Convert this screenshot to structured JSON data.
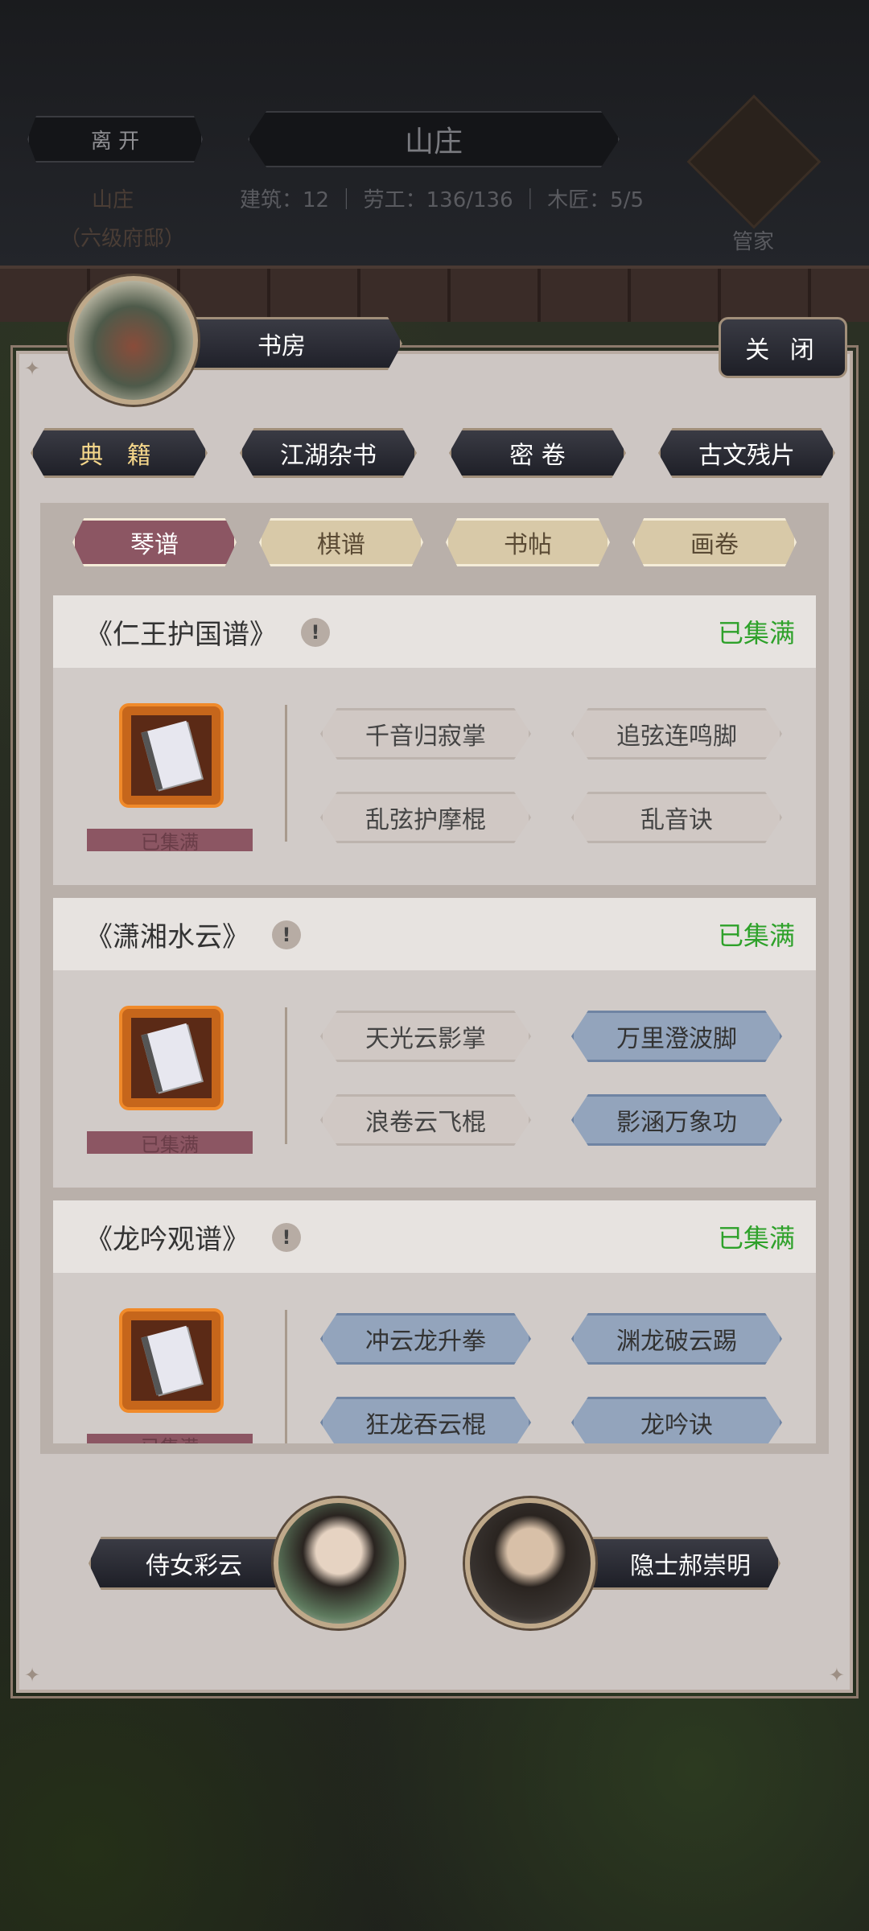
{
  "hud": {
    "leave_label": "离 开",
    "title": "山庄",
    "stats": "建筑：12 ｜ 劳工：136/136 ｜ 木匠：5/5",
    "location_name": "山庄",
    "location_level": "（六级府邸）",
    "steward_label": "管家"
  },
  "dialog": {
    "title": "书房",
    "close_label": "关 闭"
  },
  "categories": [
    "典 籍",
    "江湖杂书",
    "密 卷",
    "古文残片"
  ],
  "subcategories": [
    "琴谱",
    "棋谱",
    "书帖",
    "画卷"
  ],
  "books": [
    {
      "title": "《仁王护国谱》",
      "info": "!",
      "status": "已集满",
      "bar": "已集满",
      "skills": [
        "千音归寂掌",
        "追弦连鸣脚",
        "乱弦护摩棍",
        "乱音诀"
      ]
    },
    {
      "title": "《潇湘水云》",
      "info": "!",
      "status": "已集满",
      "bar": "已集满",
      "skills": [
        "天光云影掌",
        "万里澄波脚",
        "浪卷云飞棍",
        "影涵万象功"
      ]
    },
    {
      "title": "《龙吟观谱》",
      "info": "!",
      "status": "已集满",
      "bar": "已集满",
      "skills": [
        "冲云龙升拳",
        "渊龙破云踢",
        "狂龙吞云棍",
        "龙吟诀"
      ]
    }
  ],
  "npcs": {
    "left": "侍女彩云",
    "right": "隐士郝崇明"
  },
  "colors": {
    "collected_green": "#2ea12a",
    "active_subtab": "#8c5663",
    "learned_skill_blue": "#93a4bc"
  }
}
